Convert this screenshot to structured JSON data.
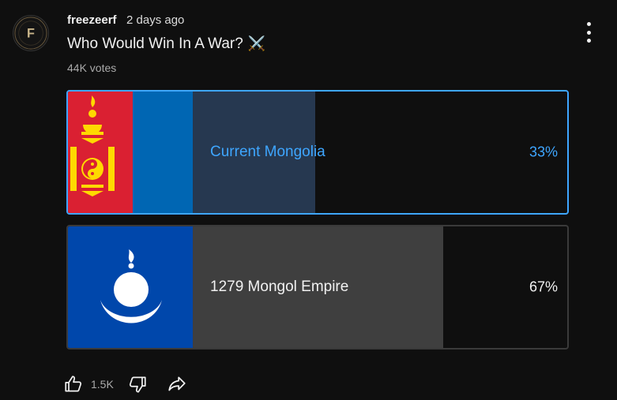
{
  "post": {
    "channel": "freezeerf",
    "posted": "2 days ago",
    "title": "Who Would Win In A War?",
    "title_emoji": "⚔️",
    "votes": "44K votes",
    "avatar": {
      "icon": "f-logo-icon",
      "letter": "F"
    }
  },
  "poll": {
    "options": [
      {
        "label": "Current Mongolia",
        "percent": "33%",
        "fill_fraction": 0.33,
        "selected": true,
        "flag_icon": "mongolia-flag-icon"
      },
      {
        "label": "1279 Mongol Empire",
        "percent": "67%",
        "fill_fraction": 0.67,
        "selected": false,
        "flag_icon": "mongol-empire-flag-icon"
      }
    ]
  },
  "actions": {
    "like_count": "1.5K",
    "like_icon": "thumbs-up-icon",
    "dislike_icon": "thumbs-down-icon",
    "share_icon": "share-icon",
    "menu_icon": "more-vertical-icon"
  },
  "colors": {
    "background": "#0f0f0f",
    "accent": "#3ea6ff",
    "selected_fill": "#263850",
    "other_fill": "#3f3f3f"
  }
}
